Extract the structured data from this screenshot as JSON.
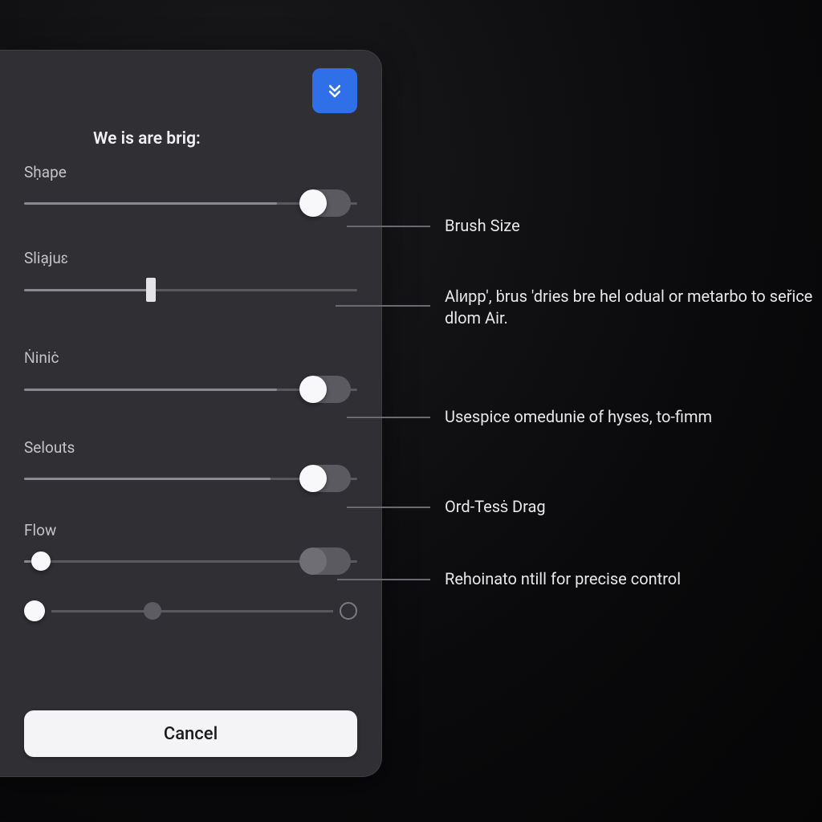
{
  "panel": {
    "title": "We is are brig:",
    "download_icon": "download-icon",
    "cancel_label": "Cancel"
  },
  "controls": {
    "shape": {
      "label": "Sḥape",
      "value_pct": 76,
      "toggle_on": true
    },
    "sliajut": {
      "label": "Sliạjuɛ",
      "value_pct": 38
    },
    "ninic": {
      "label": "Ṅiniċ",
      "value_pct": 76,
      "toggle_on": true
    },
    "selouts": {
      "label": "Selouts",
      "value_pct": 74,
      "toggle_on": true
    },
    "flow": {
      "label": "Flow",
      "value_pct": 5,
      "pill_muted": true
    }
  },
  "callouts": {
    "c1": "Brush Size",
    "c2": "Alᴎpp', ḃrus 'dries bre hel odual or metarbo to seřice dlom Air.",
    "c3": "Usespice omedunie of hyses, to-fimm",
    "c4": "Ord-Tesṡ Drag",
    "c5": "Rehoinato ntill for precise control"
  }
}
